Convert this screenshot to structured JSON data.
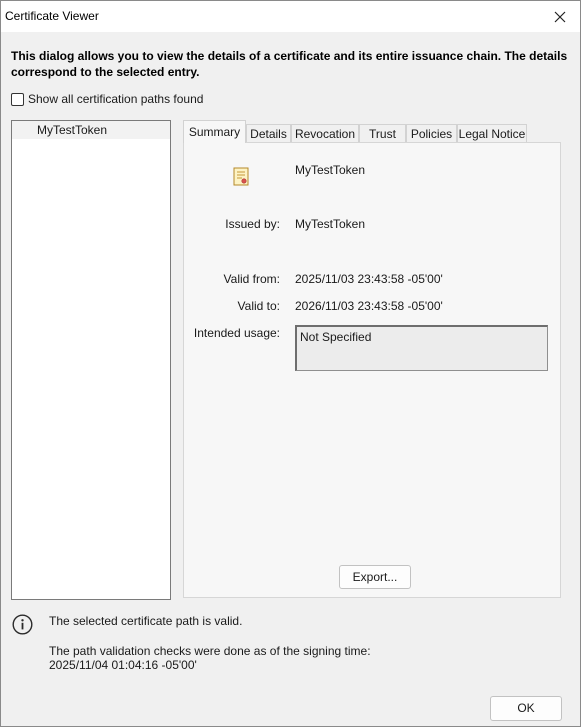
{
  "window": {
    "title": "Certificate Viewer"
  },
  "intro_text": "This dialog allows you to view the details of a certificate and its entire issuance chain. The details correspond to the selected entry.",
  "show_all_paths": {
    "label": "Show all certification paths found",
    "checked": false
  },
  "tree": {
    "items": [
      {
        "label": "MyTestToken",
        "selected": true
      }
    ]
  },
  "tabs": [
    {
      "label": "Summary",
      "active": true
    },
    {
      "label": "Details",
      "active": false
    },
    {
      "label": "Revocation",
      "active": false
    },
    {
      "label": "Trust",
      "active": false
    },
    {
      "label": "Policies",
      "active": false
    },
    {
      "label": "Legal Notice",
      "active": false
    }
  ],
  "summary": {
    "subject_name": "MyTestToken",
    "issued_by_label": "Issued by:",
    "issued_by_value": "MyTestToken",
    "valid_from_label": "Valid from:",
    "valid_from_value": "2025/11/03 23:43:58 -05'00'",
    "valid_to_label": "Valid to:",
    "valid_to_value": "2026/11/03 23:43:58 -05'00'",
    "intended_usage_label": "Intended usage:",
    "intended_usage_value": "Not Specified",
    "export_label": "Export..."
  },
  "status": {
    "line1": "The selected certificate path is valid.",
    "line2": "The path validation checks were done as of the signing time:",
    "line3": "2025/11/04 01:04:16 -05'00'"
  },
  "buttons": {
    "ok_label": "OK"
  },
  "icons": {
    "close": "close-icon",
    "certificate": "certificate-icon",
    "info": "info-icon"
  }
}
